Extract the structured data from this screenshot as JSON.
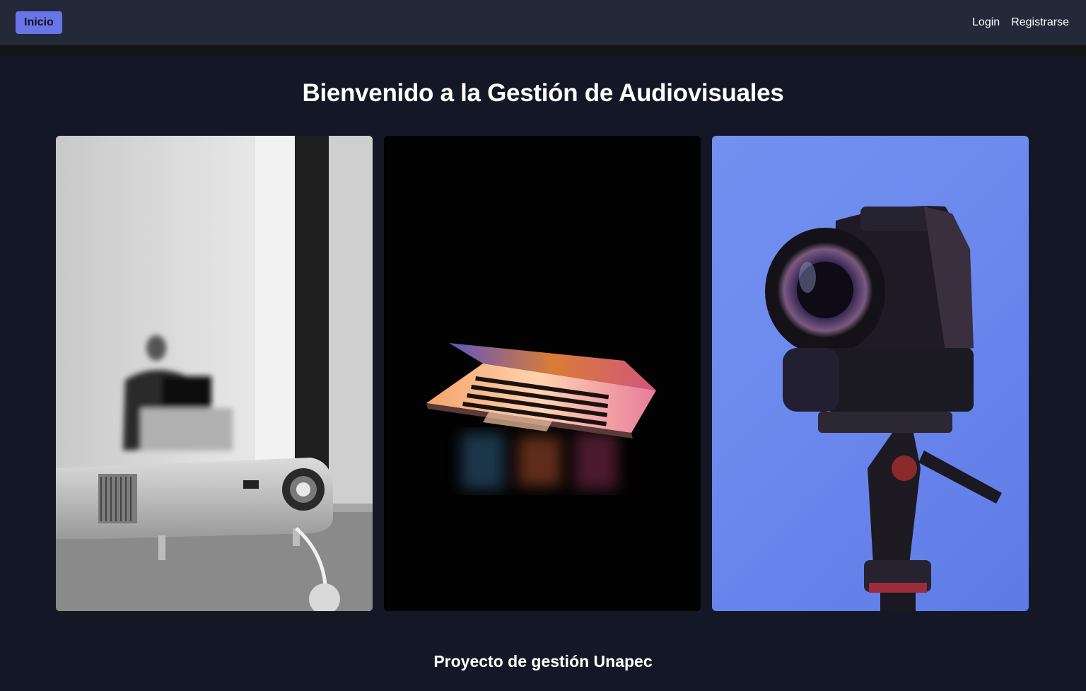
{
  "navbar": {
    "home_label": "Inicio",
    "login_label": "Login",
    "register_label": "Registrarse"
  },
  "main": {
    "title": "Bienvenido a la Gestión de Audiovisuales",
    "gallery": [
      {
        "icon": "projector-photo"
      },
      {
        "icon": "laptop-photo"
      },
      {
        "icon": "camera-photo"
      }
    ]
  },
  "footer": {
    "text": "Proyecto de gestión Unapec"
  },
  "colors": {
    "accent": "#6875e6",
    "navbar_bg": "#232938",
    "page_bg": "#141826"
  }
}
